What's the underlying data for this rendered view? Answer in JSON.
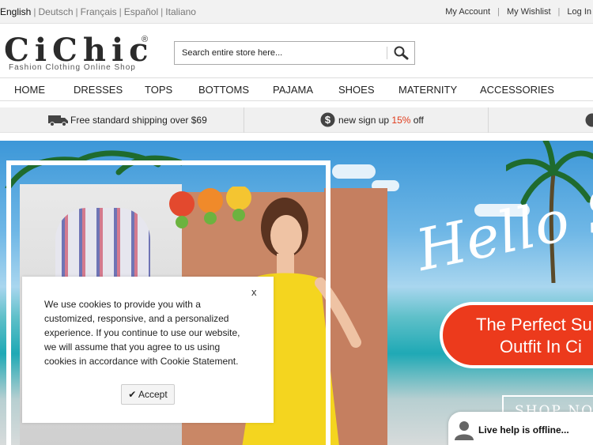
{
  "languages": [
    {
      "label": "English",
      "active": true
    },
    {
      "label": "Deutsch",
      "active": false
    },
    {
      "label": "Français",
      "active": false
    },
    {
      "label": "Español",
      "active": false
    },
    {
      "label": "Italiano",
      "active": false
    }
  ],
  "account_links": {
    "my_account": "My Account",
    "my_wishlist": "My Wishlist",
    "log_in": "Log In"
  },
  "logo": {
    "text": "CiChic",
    "registered": "®",
    "tagline": "Fashion Clothing Online Shop"
  },
  "search": {
    "placeholder": "Search entire store here...",
    "icon": "search-icon"
  },
  "nav": {
    "items": [
      "HOME",
      "DRESSES",
      "TOPS",
      "BOTTOMS",
      "PAJAMA",
      "SHOES",
      "MATERNITY",
      "ACCESSORIES"
    ]
  },
  "shipping_bar": {
    "free_shipping": "Free standard shipping over $69",
    "signup_prefix": "new sign up ",
    "signup_highlight": "15%",
    "signup_suffix": " off",
    "truck_icon": "truck-icon",
    "dollar_icon": "dollar-circle-icon",
    "highlight_color": "#e03a1a"
  },
  "banner": {
    "headline": "Hello S",
    "pill_line1": "The Perfect Su",
    "pill_line2": "Outfit In Ci",
    "cta": "SHOP NOW",
    "pill_color": "#ec3a1c"
  },
  "cookie_dialog": {
    "close": "x",
    "message": "We use cookies to provide you with a customized, responsive, and a personalized experience. If you continue to use our website, we will assume that you agree to us using cookies in accordance with Cookie Statement.",
    "accept_label": "✔ Accept"
  },
  "live_help": {
    "label": "Live help is offline...",
    "icon": "person-icon"
  }
}
